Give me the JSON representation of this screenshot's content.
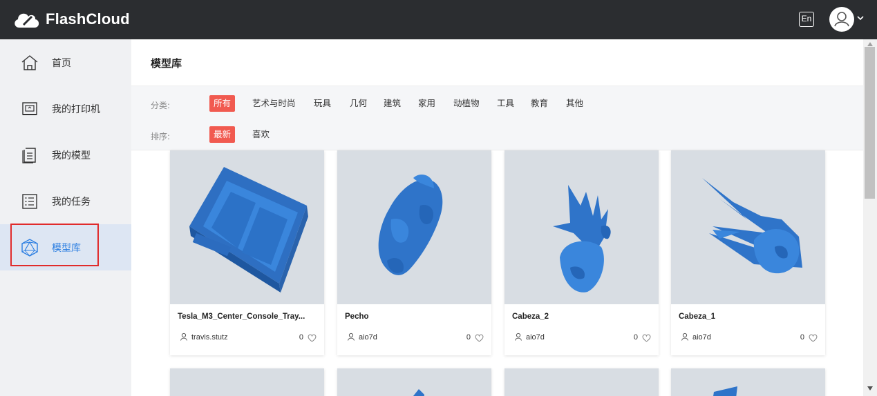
{
  "app": {
    "name": "FlashCloud",
    "lang_button": "En"
  },
  "sidebar": {
    "items": [
      {
        "label": "首页",
        "icon": "home-icon"
      },
      {
        "label": "我的打印机",
        "icon": "printer-icon"
      },
      {
        "label": "我的模型",
        "icon": "document-icon"
      },
      {
        "label": "我的任务",
        "icon": "task-list-icon"
      },
      {
        "label": "模型库",
        "icon": "model-library-icon",
        "active": true
      }
    ]
  },
  "main": {
    "title": "模型库",
    "filters": {
      "category_label": "分类:",
      "categories": [
        "所有",
        "艺术与时尚",
        "玩具",
        "几何",
        "建筑",
        "家用",
        "动植物",
        "工具",
        "教育",
        "其他"
      ],
      "category_selected": "所有",
      "sort_label": "排序:",
      "sorts": [
        "最新",
        "喜欢"
      ],
      "sort_selected": "最新"
    },
    "cards": [
      {
        "name": "Tesla_M3_Center_Console_Tray...",
        "user": "travis.stutz",
        "likes": "0"
      },
      {
        "name": "Pecho",
        "user": "aio7d",
        "likes": "0"
      },
      {
        "name": "Cabeza_2",
        "user": "aio7d",
        "likes": "0"
      },
      {
        "name": "Cabeza_1",
        "user": "aio7d",
        "likes": "0"
      }
    ]
  },
  "colors": {
    "accent": "#f15a50",
    "topbar": "#2b2d30",
    "active_blue": "#2a7de1",
    "model_blue": "#2f74c9",
    "highlight": "#e02b2b"
  }
}
